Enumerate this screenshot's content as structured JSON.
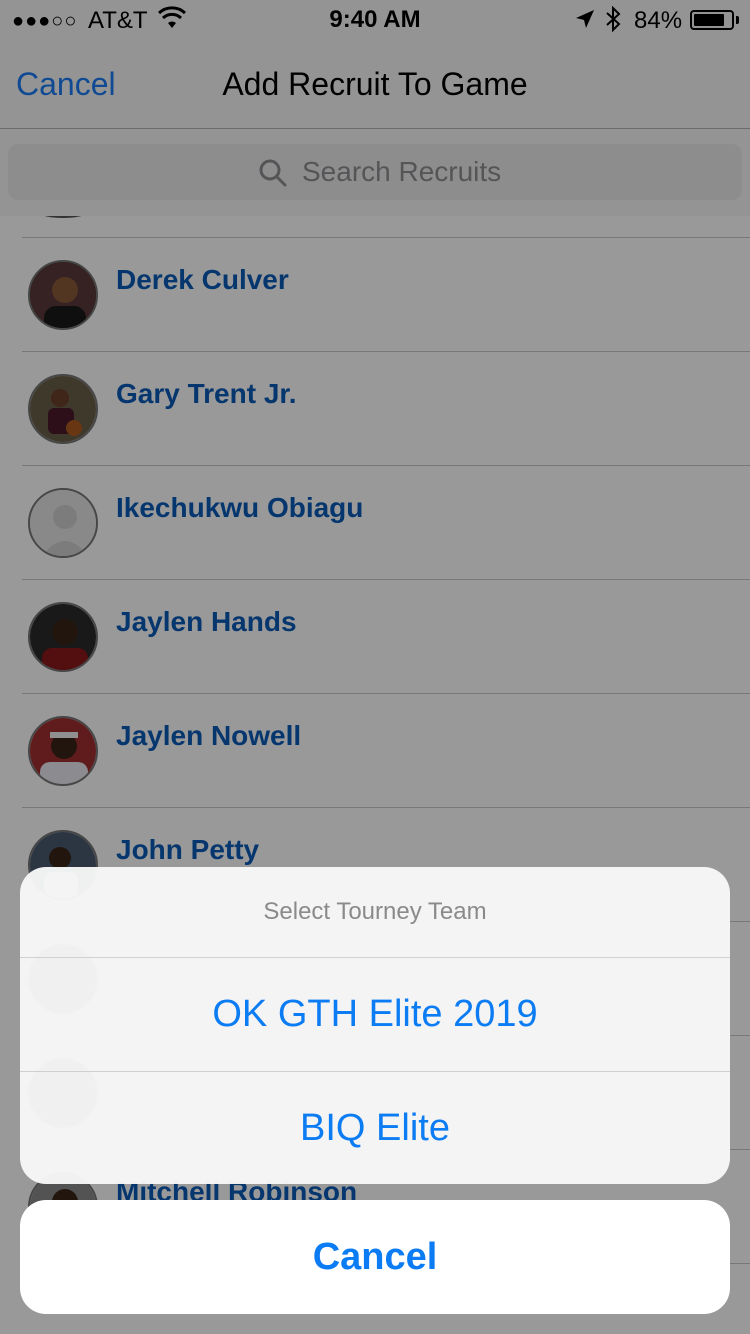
{
  "status_bar": {
    "carrier": "AT&T",
    "signal": "●●●○○",
    "time": "9:40 AM",
    "battery": "84%",
    "battery_level": 0.84,
    "icons": [
      "signal-dots-icon",
      "wifi-icon",
      "location-arrow-icon",
      "bluetooth-icon",
      "battery-icon"
    ]
  },
  "nav": {
    "cancel_label": "Cancel",
    "title": "Add Recruit To Game"
  },
  "search": {
    "placeholder": "Search Recruits",
    "icon": "search-icon"
  },
  "recruits": [
    {
      "name": "Derek Culver",
      "avatar": "photo"
    },
    {
      "name": "Gary Trent Jr.",
      "avatar": "photo"
    },
    {
      "name": "Ikechukwu Obiagu",
      "avatar": "placeholder"
    },
    {
      "name": "Jaylen Hands",
      "avatar": "photo"
    },
    {
      "name": "Jaylen Nowell",
      "avatar": "photo"
    },
    {
      "name": "John Petty",
      "avatar": "photo"
    },
    {
      "name": "",
      "avatar": "photo"
    },
    {
      "name": "",
      "avatar": "photo"
    },
    {
      "name": "Mitchell Robinson",
      "avatar": "photo"
    }
  ],
  "action_sheet": {
    "title": "Select Tourney Team",
    "options": [
      {
        "label": "OK GTH Elite 2019"
      },
      {
        "label": "BIQ Elite"
      }
    ],
    "cancel_label": "Cancel"
  },
  "colors": {
    "ios_blue": "#0b7cf3",
    "name_blue": "#0a5ab8",
    "nav_bg": "#f7f7f7"
  }
}
